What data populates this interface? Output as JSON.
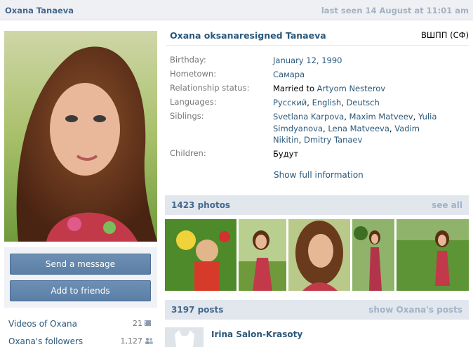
{
  "header": {
    "name": "Oxana Tanaeva",
    "last_seen": "last seen 14 August at 11:01 am"
  },
  "profile": {
    "full_name": "Oxana oksanaresigned Tanaeva",
    "university": "ВШПП (СФ)",
    "fields": {
      "birthday_label": "Birthday:",
      "birthday_value": "January 12, 1990",
      "hometown_label": "Hometown:",
      "hometown_value": "Самара",
      "relationship_label": "Relationship status:",
      "relationship_prefix": "Married to",
      "relationship_person": "Artyom Nesterov",
      "languages_label": "Languages:",
      "languages": [
        "Русский",
        "English",
        "Deutsch"
      ],
      "siblings_label": "Siblings:",
      "siblings": [
        "Svetlana Karpova",
        "Maxim Matveev",
        "Yulia Simdyanova",
        "Lena Matveeva",
        "Vadim Nikitin",
        "Dmitry Tanaev"
      ],
      "children_label": "Children:",
      "children_value": "Будут"
    },
    "show_full": "Show full information"
  },
  "actions": {
    "send_message": "Send a message",
    "add_friends": "Add to friends"
  },
  "sidebar": {
    "videos_label": "Videos of Oxana",
    "videos_count": "21",
    "followers_label": "Oxana's followers",
    "followers_count": "1,127"
  },
  "photos_section": {
    "title": "1423 photos",
    "see_all": "see all"
  },
  "posts_section": {
    "title": "3197 posts",
    "show_posts": "show Oxana's posts"
  },
  "first_post": {
    "author": "Irina Salon-Krasoty"
  },
  "colors": {
    "link": "#2b587a",
    "header_bg": "#e1e7ed",
    "button": "#5b7fa6"
  }
}
